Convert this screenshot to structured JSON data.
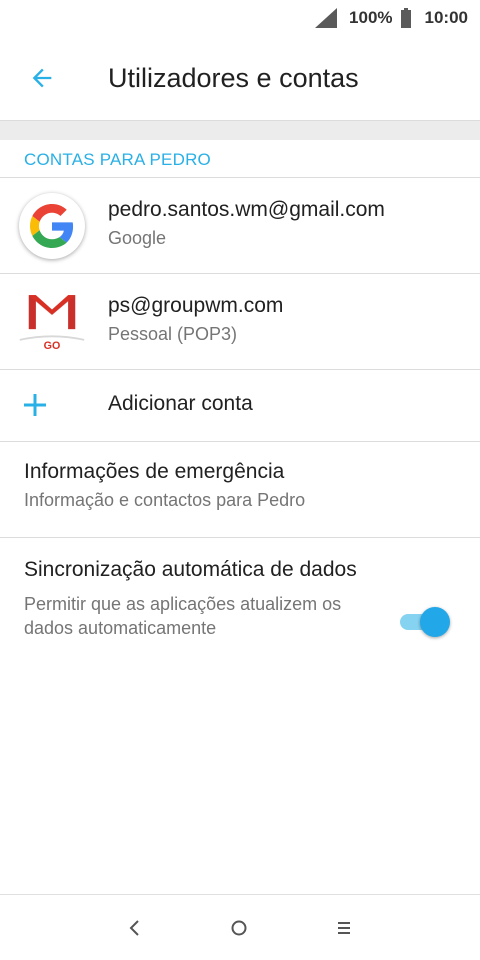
{
  "status_bar": {
    "battery_percent": "100%",
    "time": "10:00"
  },
  "app_bar": {
    "title": "Utilizadores e contas"
  },
  "section": {
    "header": "CONTAS PARA PEDRO"
  },
  "accounts": [
    {
      "email": "pedro.santos.wm@gmail.com",
      "type": "Google",
      "icon": "google-icon"
    },
    {
      "email": "ps@groupwm.com",
      "type": "Pessoal (POP3)",
      "icon": "gmail-go-icon",
      "icon_badge": "GO"
    }
  ],
  "add_account": {
    "label": "Adicionar conta"
  },
  "emergency": {
    "title": "Informações de emergência",
    "subtitle": "Informação e contactos para Pedro"
  },
  "auto_sync": {
    "title": "Sincronização automática de dados",
    "subtitle": "Permitir que as aplicações atualizem os dados automaticamente",
    "enabled": true
  },
  "colors": {
    "accent": "#29b0e6",
    "toggle_thumb": "#22a7e8",
    "toggle_track": "#86d3f1"
  },
  "nav_bar": {
    "back": "back-icon",
    "home": "home-icon",
    "recents": "recents-icon"
  }
}
